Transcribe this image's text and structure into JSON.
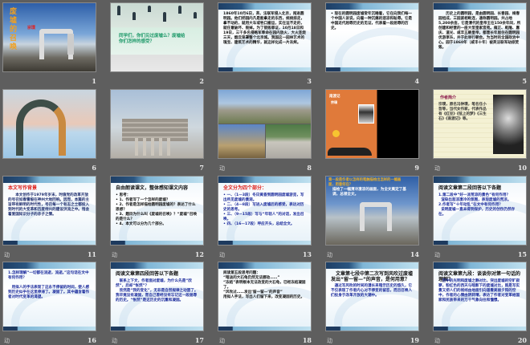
{
  "view": "slide-sorter",
  "animation_marker": "动",
  "slides": [
    {
      "number": "1",
      "kind": "cover",
      "title": "废墟的召唤",
      "author": "宗璞",
      "animated": false
    },
    {
      "number": "2",
      "kind": "question",
      "title": "同学们，你们见过废墟么？废墟给你们怎样的感受？",
      "animated": false
    },
    {
      "number": "3",
      "kind": "text",
      "title": "",
      "title_color": "#000",
      "body_color": "#111",
      "body": "1860年10月6日，英、法联军侵入北京，闯进圆明园。他们把园内凡是能拿走的东西，统统掠走，拿不动的，就用大车或牲口搬运，实在运不走的，就任意破坏、毁掉。为了销毁罪证，10月18日和19日，三千多名侵略军奉命在园内放火，大火连烧三天，烟云笼罩整个北京城。我国这一园林艺术的瑰宝、建筑艺术的精华，就这样化成一片灰烬。",
      "animated": false
    },
    {
      "number": "4",
      "kind": "text",
      "title": "",
      "title_color": "#000",
      "body_color": "#111",
      "body": "• 现在的圆明园废墟常年沉睡着，它在向我们每一个中国人诉说，向着一种沉痛的悲凉和耻辱。它是中国近代屈辱历史的见证，代表着一段屈辱的历史。",
      "animated": false
    },
    {
      "number": "5",
      "kind": "text",
      "title": "",
      "title_color": "#000",
      "body_color": "#111",
      "body": "　　历史上的圆明园，是由圆明园、长春园、绮春园组成，三园紧相毗连，通称圆明园。共占地5,200余亩，它是清代的皇帝王在150余年间，所创建和经营的一座大型皇家宫苑。雍正、乾隆、嘉庆、道光、咸丰五朝皇帝，都曾长年居住在圆明园优游享乐，并于此举行朝会。为当时的全国政治中心。园于1860年（咸丰十年）被英法联军劫掠焚毁。",
      "animated": false
    },
    {
      "number": "6",
      "kind": "photo-arch",
      "animated": false
    },
    {
      "number": "7",
      "kind": "photo-ruin",
      "animated": false
    },
    {
      "number": "8",
      "kind": "photo-collage",
      "animated": true
    },
    {
      "number": "9",
      "kind": "book",
      "book_title": "南渡记",
      "author": "宗璞",
      "animated": false
    },
    {
      "number": "10",
      "kind": "author",
      "title": "作者简介",
      "body": "宗璞，原名冯钟璞，笔名任小哲等，当代女作家。代表作品有《红豆》《弦上的梦》《三生石》《南渡记》等。",
      "animated": true
    },
    {
      "number": "11",
      "kind": "text",
      "title": "本文写作背景",
      "title_color": "#e0211b",
      "body_color": "#1a2a6c",
      "body": "　　本文创作于1979年岁末，时值党的改革开放的号召如春雷般在神州大地回响。因而，本篇的主旨带有鲜明的时代性，号召每一个有志之士都投入到时代的大变革和百废待兴的建设洪流之中。饱含着爱国知识分子的赤子之情。",
      "animated": true
    },
    {
      "number": "12",
      "kind": "text",
      "title": "自由朗读课文，整体感知课文内容",
      "title_color": "#111",
      "body_color": "#111",
      "body": "• 思考：\n• 1、作者写了一个怎样的废墟？\n• 2、作者是怎样描绘圆明园废墟的？表达了什么思想？\n• 3、题目为什么叫《废墟的召唤》？“废墟”召唤的是什么？\n• 4、本文可以分为几个部分。",
      "animated": true
    },
    {
      "number": "13",
      "kind": "text",
      "title": "全文分为四个部分：",
      "title_color": "#e0211b",
      "body_color": "#1a2a9c",
      "body": "• 一、（1—3段）冬日黄昏到圆明园废墟游览，写出所见废墟的景观。\n• 二、（4—8段）写进入废墟后的感受，表达对历史的思考。\n• 三、（9—15段）写与“年轻人”的对话，发出召唤。\n• 四、（16—17段）呼应开头，总结全文。",
      "animated": true
    },
    {
      "number": "14",
      "kind": "photo-text",
      "title": "第一段是作者以怎样的笔触描绘出怎样的一幅画面，用意何在？",
      "body": "描绘了一幅清冷凄凉的画面，为全文奠定了基调，总领全文。",
      "animated": true
    },
    {
      "number": "15",
      "kind": "text",
      "title": "阅读文章第二段回答以下各题",
      "title_color": "#111",
      "body_color": "#1a2a9c",
      "body": "1.第二段中“好一派荒凉的景色”有何作用？\n  渲染出悲凉凄冷的氛围，表现废墟的荒凉。\n2.作者写“十年动乱”在文中有何作用？\n  说明废墟一直未得到保护，历史的创伤仍然存在。",
      "animated": true
    },
    {
      "number": "16",
      "kind": "text",
      "title": "",
      "title_color": "#111",
      "body_color": "#1a2a9c",
      "body": "1.怎样理解“一切都在流逝，流逝。”这句话在文中有何作用？\n\n　用拟人的手法表现了这永不停留的时间，使人感到历史似乎在这里停滞了。凝固了。其中蕴含着作者对时代变革的渴望。",
      "animated": true
    },
    {
      "number": "17",
      "kind": "text",
      "title": "阅读文章第四段回答以下各题",
      "title_color": "#111",
      "body_color": "#1a2a9c",
      "body": "　联系上下文，作者面对废墟，为什么先是“欣然”，后却“怅然”？\n　欣然是“我的变化”，无非是自然规律之动罢了。我毕竟没有凝固，而自己曾经没有忘记这一段屈辱的历史。“怅然”是这历史的沉重和凝固。",
      "animated": true
    },
    {
      "number": "18",
      "kind": "text",
      "title": "",
      "title_color": "#111",
      "body_color": "#111",
      "body": "阅读第五段思考问题：\n“暗淡的大石龟仍然无法挪动……”\n“冻结”表明根本无法改变的大石龟，已经冻结凝固了。\n“风吹过……发出‘留一留—’的声音”\n用拟人手法，写出人们留下来，改变凝固的历史。",
      "animated": true
    },
    {
      "number": "19",
      "kind": "text",
      "title": "　文章第七段中第二次写到风吹过废墟发出“留一留—”的声音，是何用意？",
      "title_color": "#111",
      "body_color": "#1a2a9c",
      "body": "　通过写风吹的时间的漫长来暗示历史的悠久，它不仅表现了作者内心对不停变的留恋，而且召唤人们投身于改革开放的大潮中。",
      "animated": true
    },
    {
      "number": "20",
      "kind": "text",
      "title": "阅读文章第九段：谈谈你对第一句话的理解？",
      "title_color": "#111",
      "body_color": "#1a2a9c",
      "body": "　空中的光明和废墟之静对比，突出废墟的空旷寂寥，粉红色的西天与暗影下的废墟对比，既是写实景又把人们的视线由地面引向遥看美丽夕阳的空中，作者的心情由阴转晴，表达了作者对变革给国家和民族带来的万千气象向往和憧憬。",
      "animated": true
    }
  ]
}
